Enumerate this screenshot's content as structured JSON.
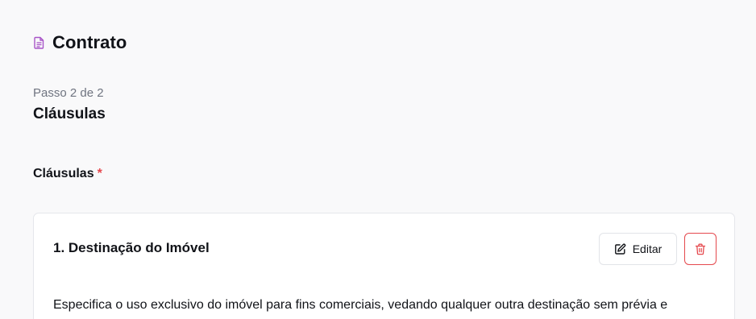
{
  "header": {
    "title": "Contrato",
    "icon": "document-icon",
    "icon_color": "#a855c7"
  },
  "step": {
    "progress": "Passo 2 de 2",
    "title": "Cláusulas"
  },
  "clauses_field": {
    "label": "Cláusulas",
    "required_marker": "*",
    "required_color": "#e5484d"
  },
  "clauses": [
    {
      "title": "1. Destinação do Imóvel",
      "text": "Especifica o uso exclusivo do imóvel para fins comerciais, vedando qualquer outra destinação sem prévia e",
      "edit_label": "Editar",
      "edit_icon": "pencil-square-icon",
      "delete_icon": "trash-icon"
    }
  ]
}
